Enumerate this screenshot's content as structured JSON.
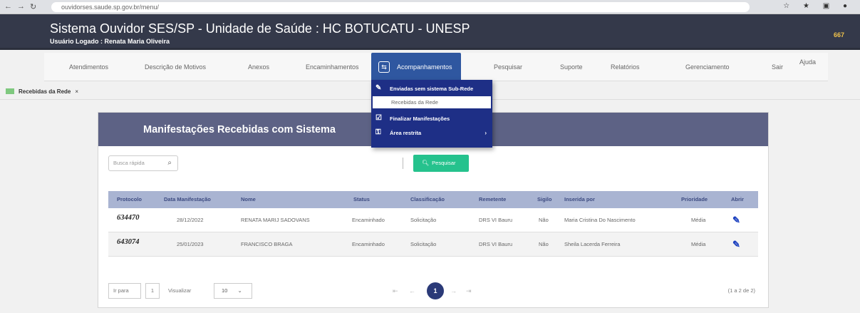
{
  "browser": {
    "url": "ouvidorses.saude.sp.gov.br/menu/"
  },
  "header": {
    "title": "Sistema Ouvidor SES/SP - Unidade de Saúde : HC BOTUCATU - UNESP",
    "user": "Usuário Logado : Renata Maria Oliveira",
    "code": "667"
  },
  "menu": {
    "items": [
      "Atendimentos",
      "Descrição de Motivos",
      "Anexos",
      "Encaminhamentos",
      "Acompanhamentos",
      "Pesquisar",
      "Suporte",
      "Relatórios",
      "Gerenciamento",
      "Sair",
      "Ajuda"
    ]
  },
  "dropdown": {
    "items": [
      "Enviadas sem sistema Sub-Rede",
      "Recebidas da Rede",
      "Finalizar Manifestações",
      "Área restrita"
    ]
  },
  "tab": {
    "label": "Recebidas da Rede",
    "close": "×"
  },
  "panel": {
    "title": "Manifestações Recebidas com Sistema",
    "search_placeholder": "Busca rápida",
    "search_button": "Pesquisar"
  },
  "table": {
    "columns": [
      "Protocolo",
      "Data Manifestação",
      "Nome",
      "Status",
      "Classificação",
      "Remetente",
      "Sigilo",
      "Inserida por",
      "Prioridade",
      "Abrir"
    ],
    "rows": [
      [
        "634470",
        "28/12/2022",
        "RENATA MARIJ SADOVANS",
        "Encaminhado",
        "Solicitação",
        "DRS VI Bauru",
        "Não",
        "Maria Cristina Do Nascimento",
        "Média"
      ],
      [
        "643074",
        "25/01/2023",
        "FRANCISCO BRAGA",
        "Encaminhado",
        "Solicitação",
        "DRS VI Bauru",
        "Não",
        "Sheila Lacerda Ferreira",
        "Média"
      ]
    ]
  },
  "footer": {
    "goto_label": "Ir para",
    "goto_value": "1",
    "view_label": "Visualizar",
    "view_value": "10",
    "current_page": "1",
    "count": "(1 a 2 de 2)"
  },
  "colors": {
    "header_bg": "#34394a",
    "menu_active": "#2f57a0",
    "dropdown_bg": "#1e2f86",
    "panel_head": "#5d6285",
    "table_head": "#a9b4d2",
    "search_button": "#25c28d",
    "pager_active": "#2b3a78"
  }
}
